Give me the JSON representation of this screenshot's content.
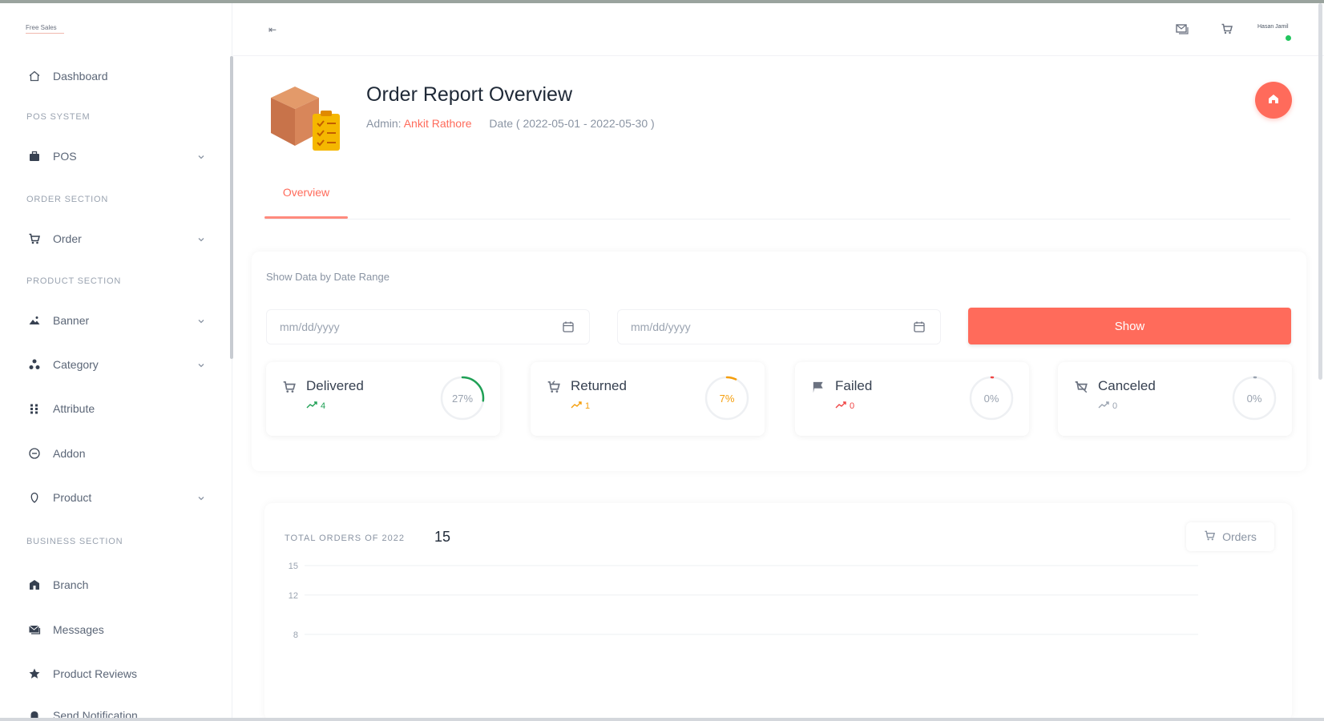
{
  "app": {
    "brand": "Free Sales",
    "user_name": "Hasan Jamil"
  },
  "sidebar": {
    "items": [
      {
        "type": "item",
        "label": "Dashboard",
        "icon": "home-icon"
      },
      {
        "type": "section",
        "label": "POS SYSTEM"
      },
      {
        "type": "item",
        "label": "POS",
        "icon": "briefcase-icon",
        "has_children": true
      },
      {
        "type": "section",
        "label": "ORDER SECTION"
      },
      {
        "type": "item",
        "label": "Order",
        "icon": "cart-icon",
        "has_children": true
      },
      {
        "type": "section",
        "label": "PRODUCT SECTION"
      },
      {
        "type": "item",
        "label": "Banner",
        "icon": "image-icon",
        "has_children": true
      },
      {
        "type": "item",
        "label": "Category",
        "icon": "category-icon",
        "has_children": true
      },
      {
        "type": "item",
        "label": "Attribute",
        "icon": "attribute-icon"
      },
      {
        "type": "item",
        "label": "Addon",
        "icon": "addon-icon"
      },
      {
        "type": "item",
        "label": "Product",
        "icon": "product-icon",
        "has_children": true
      },
      {
        "type": "section",
        "label": "BUSINESS SECTION"
      },
      {
        "type": "item",
        "label": "Branch",
        "icon": "branch-icon"
      },
      {
        "type": "item",
        "label": "Messages",
        "icon": "messages-icon"
      },
      {
        "type": "item",
        "label": "Product Reviews",
        "icon": "star-icon"
      },
      {
        "type": "item",
        "label": "Send Notification",
        "icon": "bell-icon"
      }
    ]
  },
  "header": {
    "toggle_glyph": "⇤",
    "icons": [
      "message-icon",
      "cart-icon"
    ]
  },
  "page": {
    "title": "Order Report Overview",
    "admin_prefix": "Admin:",
    "admin_name": "Ankit Rathore",
    "date_label": "Date",
    "date_range": "( 2022-05-01 - 2022-05-30 )",
    "tab_overview": "Overview"
  },
  "range": {
    "title": "Show Data by Date Range",
    "from_placeholder": "mm/dd/yyyy",
    "to_placeholder": "mm/dd/yyyy",
    "show_label": "Show"
  },
  "stats": [
    {
      "label": "Delivered",
      "count": "4",
      "percent": "27%",
      "fraction": 0.27,
      "color": "#1fa055",
      "icon": "cart-icon"
    },
    {
      "label": "Returned",
      "count": "1",
      "percent": "7%",
      "fraction": 0.07,
      "color": "#f59e0b",
      "icon": "return-icon"
    },
    {
      "label": "Failed",
      "count": "0",
      "percent": "0%",
      "fraction": 0,
      "color": "#ef4444",
      "icon": "flag-icon"
    },
    {
      "label": "Canceled",
      "count": "0",
      "percent": "0%",
      "fraction": 0,
      "color": "#9aa3b0",
      "icon": "cancel-icon"
    }
  ],
  "colors": {
    "accent": "#ff6b5b"
  },
  "chart": {
    "title": "TOTAL ORDERS OF 2022",
    "total": "15",
    "orders_label": "Orders"
  },
  "chart_data": {
    "type": "line",
    "title": "TOTAL ORDERS OF 2022",
    "ylim": [
      0,
      15
    ],
    "y_ticks": [
      15,
      12,
      8
    ],
    "grid": true,
    "series": []
  }
}
